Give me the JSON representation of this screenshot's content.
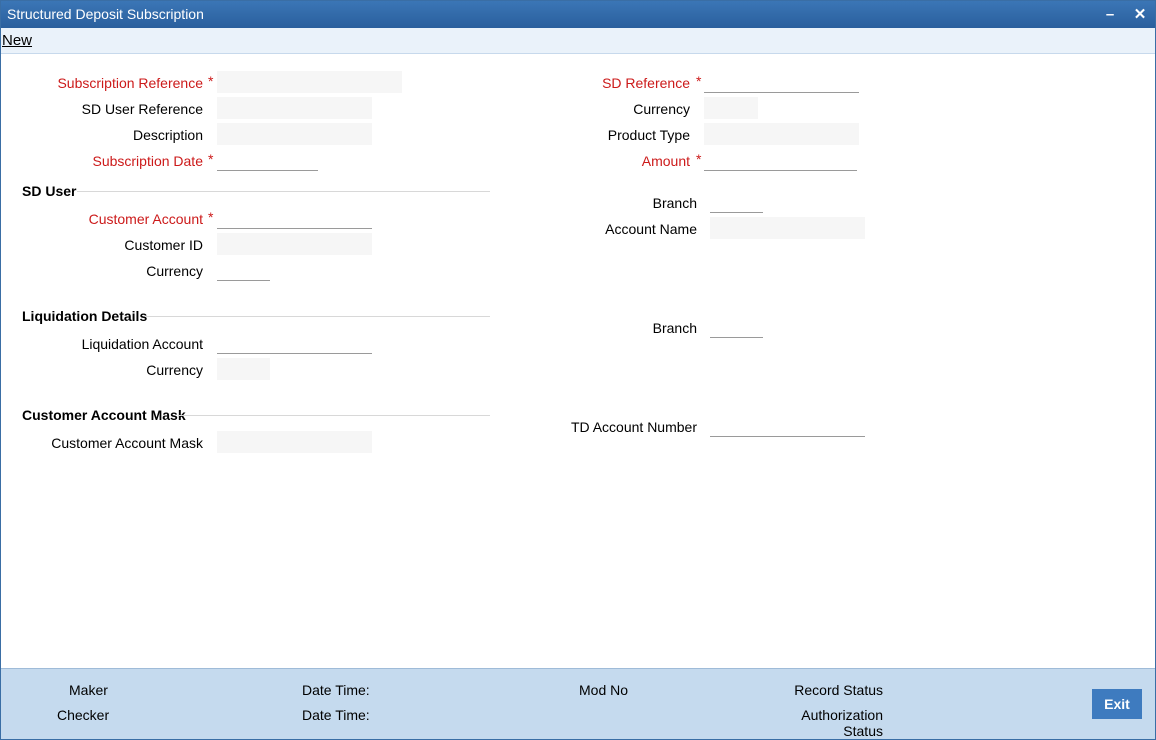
{
  "window": {
    "title": "Structured Deposit Subscription"
  },
  "menu": {
    "new_label": "New"
  },
  "form": {
    "subscription_reference": {
      "label": "Subscription Reference",
      "value": ""
    },
    "sd_user_reference": {
      "label": "SD User Reference",
      "value": ""
    },
    "description": {
      "label": "Description",
      "value": ""
    },
    "subscription_date": {
      "label": "Subscription Date",
      "value": ""
    },
    "sd_reference": {
      "label": "SD Reference",
      "value": ""
    },
    "currency": {
      "label": "Currency",
      "value": ""
    },
    "product_type": {
      "label": "Product Type",
      "value": ""
    },
    "amount": {
      "label": "Amount",
      "value": ""
    },
    "required_marker": "*"
  },
  "sd_user": {
    "heading": "SD User",
    "customer_account": {
      "label": "Customer Account",
      "value": ""
    },
    "customer_id": {
      "label": "Customer ID",
      "value": ""
    },
    "currency": {
      "label": "Currency",
      "value": ""
    },
    "branch": {
      "label": "Branch",
      "value": ""
    },
    "account_name": {
      "label": "Account Name",
      "value": ""
    }
  },
  "liquidation": {
    "heading": "Liquidation Details",
    "liquidation_account": {
      "label": "Liquidation Account",
      "value": ""
    },
    "currency": {
      "label": "Currency",
      "value": ""
    },
    "branch": {
      "label": "Branch",
      "value": ""
    }
  },
  "account_mask": {
    "heading": "Customer Account Mask",
    "customer_account_mask": {
      "label": "Customer Account Mask",
      "value": ""
    },
    "td_account_number": {
      "label": "TD Account Number",
      "value": ""
    }
  },
  "footer": {
    "maker": "Maker",
    "checker": "Checker",
    "date_time_1": "Date Time:",
    "date_time_2": "Date Time:",
    "mod_no": "Mod No",
    "record_status": "Record Status",
    "authorization_status_line1": "Authorization",
    "authorization_status_line2": "Status",
    "exit_label": "Exit"
  },
  "colors": {
    "titlebar": "#2f67a8",
    "required": "#cc1a1a",
    "footer": "#c5daee",
    "exit_button": "#3e7bbf"
  }
}
